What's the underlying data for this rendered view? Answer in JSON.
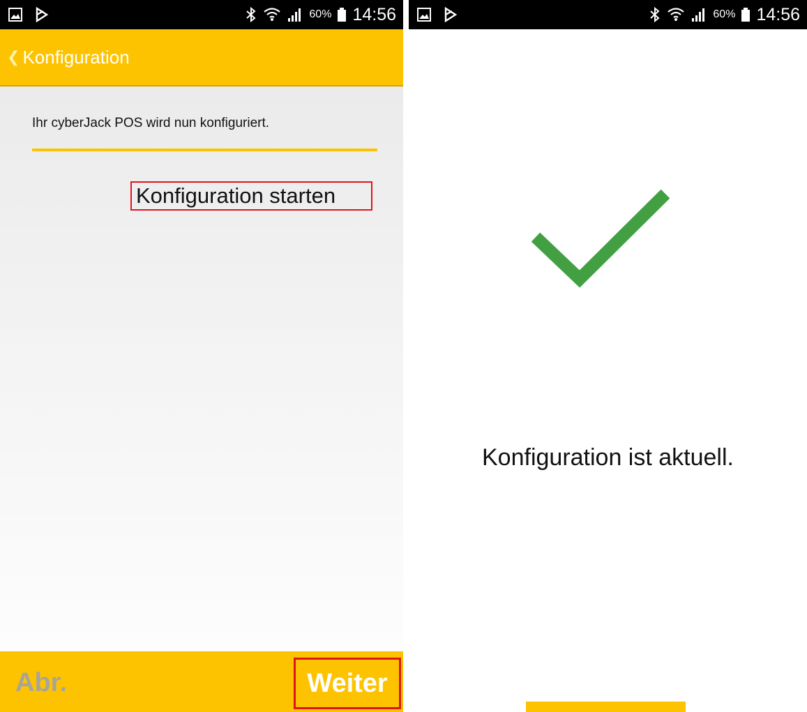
{
  "left_screen": {
    "statusbar": {
      "battery_pct": "60%",
      "time": "14:56"
    },
    "appbar": {
      "title": "Konfiguration"
    },
    "intro_text": "Ihr cyberJack POS wird nun konfiguriert.",
    "start_link_label": "Konfiguration starten",
    "bottombar": {
      "abort_label": "Abr.",
      "next_label": "Weiter"
    }
  },
  "right_screen": {
    "statusbar": {
      "battery_pct": "60%",
      "time": "14:56"
    },
    "status_text": "Konfiguration ist aktuell."
  },
  "colors": {
    "accent": "#fec300",
    "highlight_box": "#e0151c",
    "success": "#43a042",
    "disabled": "#a8a49a"
  },
  "icons": [
    "gallery-icon",
    "notification-flag-icon",
    "bluetooth-icon",
    "wifi-icon",
    "signal-icon",
    "battery-icon",
    "chevron-left-icon",
    "checkmark-icon"
  ]
}
